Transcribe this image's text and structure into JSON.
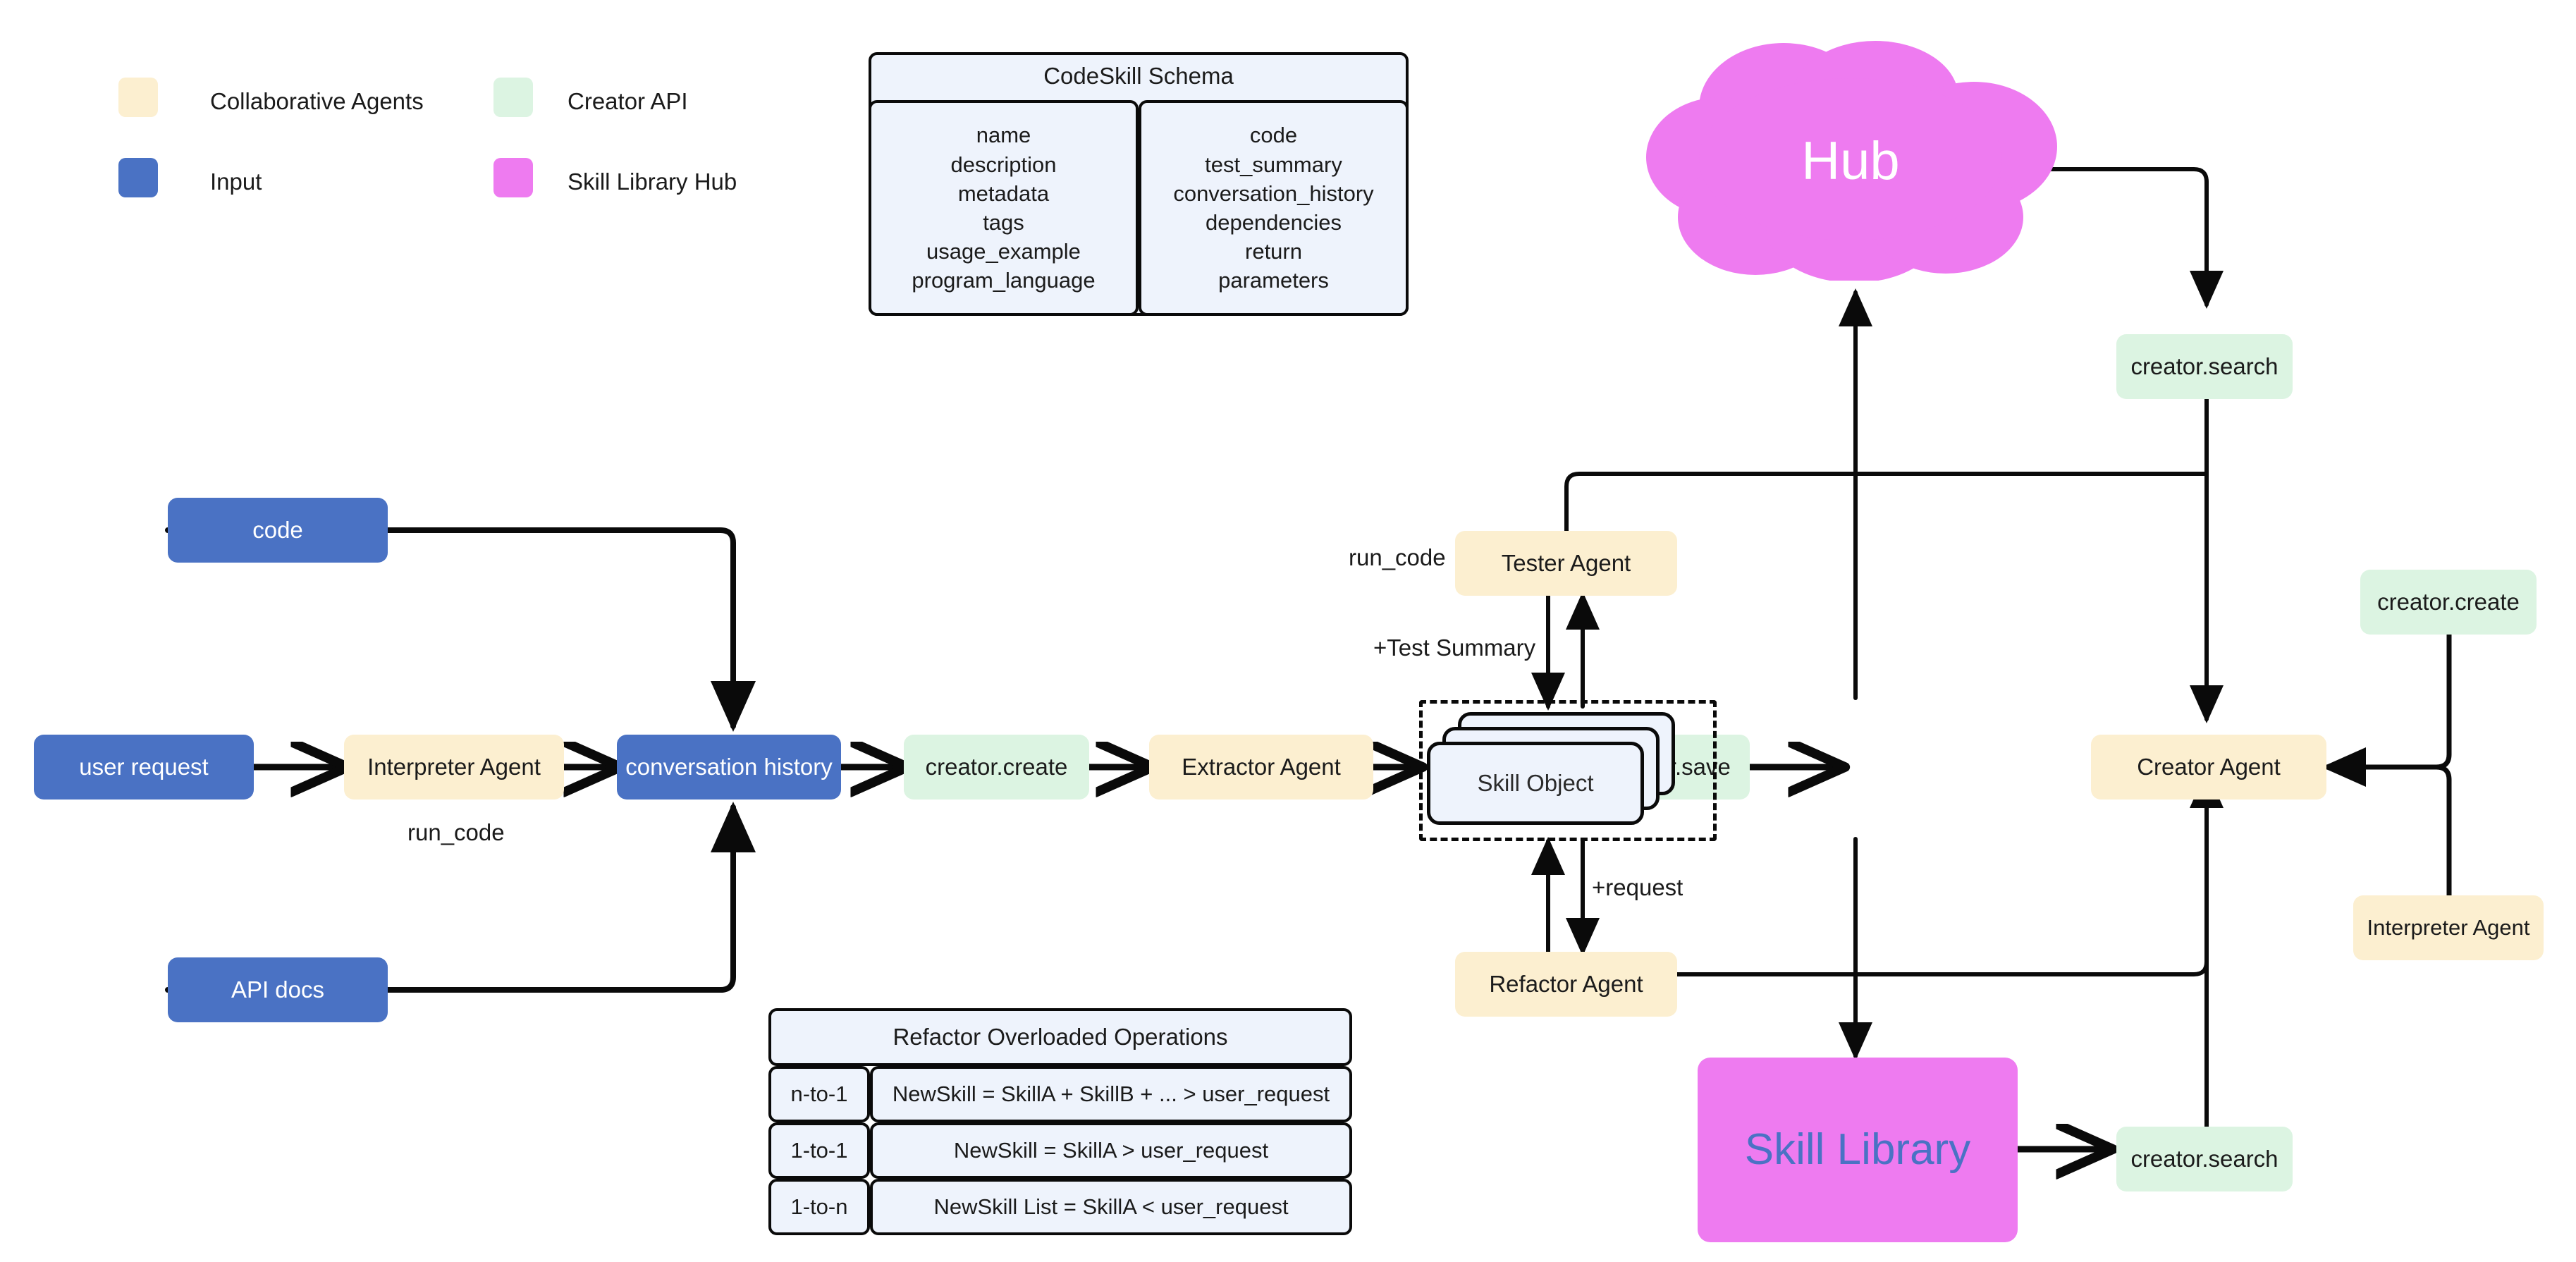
{
  "legend": {
    "items": [
      {
        "label": "Collaborative Agents",
        "color": "#FCEFD0"
      },
      {
        "label": "Creator API",
        "color": "#DCF4E2"
      },
      {
        "label": "Input",
        "color": "#4A72C4"
      },
      {
        "label": "Skill Library Hub",
        "color": "#EE7BF0"
      }
    ]
  },
  "schema": {
    "title": "CodeSkill Schema",
    "left_fields": [
      "name",
      "description",
      "metadata",
      "tags",
      "usage_example",
      "program_language"
    ],
    "right_fields": [
      "code",
      "test_summary",
      "conversation_history",
      "dependencies",
      "return",
      "parameters"
    ]
  },
  "refactor_table": {
    "title": "Refactor Overloaded Operations",
    "rows": [
      {
        "key": "n-to-1",
        "value": "NewSkill = SkillA + SkillB + ...  > user_request"
      },
      {
        "key": "1-to-1",
        "value": "NewSkill = SkillA > user_request"
      },
      {
        "key": "1-to-n",
        "value": "NewSkill List = SkillA < user_request"
      }
    ]
  },
  "nodes": {
    "user_request": "user request",
    "interpreter_agent_main": "Interpreter Agent",
    "conversation_history": "conversation history",
    "code": "code",
    "api_docs": "API docs",
    "creator_create_main": "creator.create",
    "extractor_agent": "Extractor Agent",
    "skill_object": "Skill Object",
    "tester_agent": "Tester Agent",
    "refactor_agent": "Refactor Agent",
    "creator_save": "creator.save",
    "creator_agent": "Creator Agent",
    "creator_search_top": "creator.search",
    "creator_search_bottom": "creator.search",
    "creator_create_right": "creator.create",
    "interpreter_agent_right": "Interpreter Agent",
    "hub": "Hub",
    "skill_library": "Skill Library"
  },
  "edge_labels": {
    "run_code_left": "run_code",
    "run_code_tester": "run_code",
    "test_summary": "+Test Summary",
    "request": "+request"
  },
  "colors": {
    "collaborative_agents": "#FCEFD0",
    "creator_api": "#DCF4E2",
    "input": "#4A72C4",
    "skill_library_hub": "#EE7BF0",
    "card_fill": "#EEF3FC",
    "stroke": "#0a0a0a",
    "skill_library_text": "#4A72C4"
  }
}
